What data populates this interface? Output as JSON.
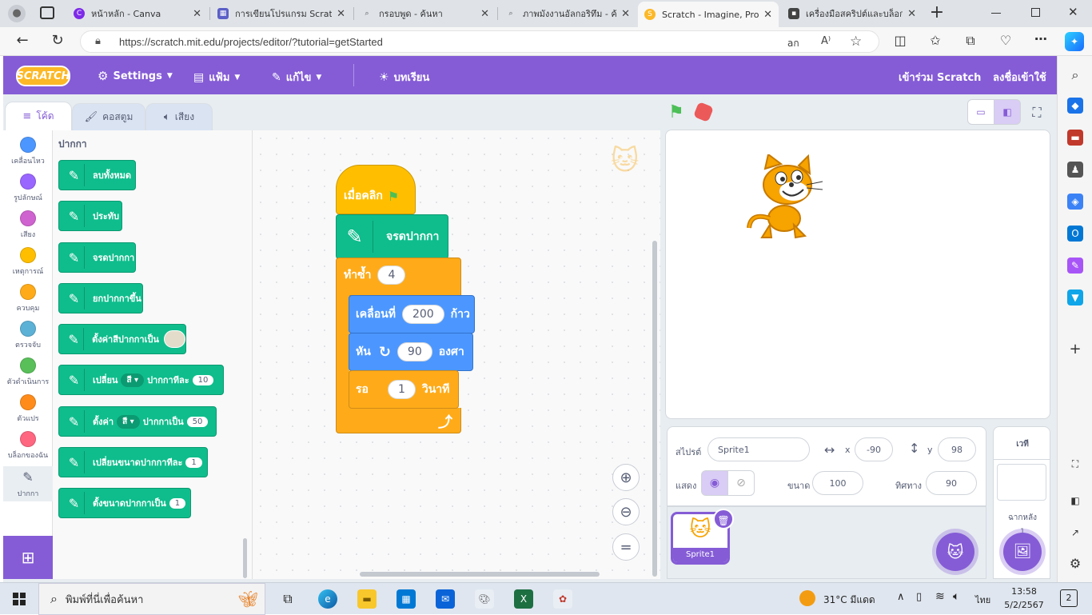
{
  "browser": {
    "tabs": [
      {
        "title": "หน้าหลัก - Canva",
        "icon_color": "#7d2ae8"
      },
      {
        "title": "การเขียนโปรแกรม Scratc",
        "icon_color": "#5b5fc7"
      },
      {
        "title": "กรอบพูด - ค้นหา",
        "icon_color": "#555555"
      },
      {
        "title": "ภาพมังงานอัลกอริทึม - ค้",
        "icon_color": "#555555"
      },
      {
        "title": "Scratch - Imagine, Pro",
        "icon_color": "#fcb827"
      },
      {
        "title": "เครื่องมือสคริปต์และบล็อก",
        "icon_color": "#444444"
      }
    ],
    "url": "https://scratch.mit.edu/projects/editor/?tutorial=getStarted",
    "new_tab": "+"
  },
  "menu": {
    "logo": "SCRATCH",
    "settings": "Settings",
    "file": "แฟ้ม",
    "edit": "แก้ไข",
    "tutorials": "บทเรียน",
    "join": "เข้าร่วม Scratch",
    "signin": "ลงชื่อเข้าใช้"
  },
  "editor_tabs": {
    "code": "โค้ด",
    "costumes": "คอสตูม",
    "sounds": "เสียง"
  },
  "categories": [
    {
      "label": "เคลื่อนไหว",
      "color": "#4c97ff"
    },
    {
      "label": "รูปลักษณ์",
      "color": "#9966ff"
    },
    {
      "label": "เสียง",
      "color": "#cf63cf"
    },
    {
      "label": "เหตุการณ์",
      "color": "#ffbf00"
    },
    {
      "label": "ควบคุม",
      "color": "#ffab19"
    },
    {
      "label": "ตรวจจับ",
      "color": "#5cb1d6"
    },
    {
      "label": "ตัวดำเนินการ",
      "color": "#59c059"
    },
    {
      "label": "ตัวแปร",
      "color": "#ff8c1a"
    },
    {
      "label": "บล็อกของฉัน",
      "color": "#ff6680"
    },
    {
      "label": "ปากกา",
      "color": "#0fbd8c"
    }
  ],
  "palette": {
    "heading": "ปากกา",
    "blocks": {
      "erase_all": "ลบทั้งหมด",
      "stamp": "ประทับ",
      "pen_down": "จรดปากกา",
      "pen_up": "ยกปากกาขึ้น",
      "set_color": "ตั้งค่าสีปากกาเป็น",
      "change_by_1": "เปลี่ยน",
      "change_by_2": "ปากกาทีละ",
      "change_by_dd": "สี",
      "change_by_val": "10",
      "set_to_1": "ตั้งค่า",
      "set_to_2": "ปากกาเป็น",
      "set_to_dd": "สี",
      "set_to_val": "50",
      "change_size": "เปลี่ยนขนาดปากกาทีละ",
      "change_size_val": "1",
      "set_size": "ตั้งขนาดปากกาเป็น",
      "set_size_val": "1"
    }
  },
  "script": {
    "when_clicked": "เมื่อคลิก",
    "pen_down": "จรดปากกา",
    "repeat": "ทำซ้ำ",
    "repeat_val": "4",
    "move": "เคลื่อนที่",
    "move_val": "200",
    "move_unit": "ก้าว",
    "turn": "หัน",
    "turn_val": "90",
    "turn_unit": "องศา",
    "wait": "รอ",
    "wait_val": "1",
    "wait_unit": "วินาที"
  },
  "sprite_info": {
    "sprite_label": "สไปรต์",
    "sprite_name": "Sprite1",
    "x_label": "x",
    "x": "-90",
    "y_label": "y",
    "y": "98",
    "show_label": "แสดง",
    "size_label": "ขนาด",
    "size": "100",
    "direction_label": "ทิศทาง",
    "direction": "90"
  },
  "sprite_list": {
    "thumb_name": "Sprite1"
  },
  "stage_panel": {
    "title": "เวที",
    "backdrops_label": "ฉากหลัง",
    "backdrops_count": "1"
  },
  "taskbar": {
    "search": "พิมพ์ที่นี่เพื่อค้นหา",
    "weather": "31°C  มีแดด",
    "lang": "ไทย",
    "time": "13:58",
    "date": "5/2/2567",
    "notifications": "2"
  }
}
